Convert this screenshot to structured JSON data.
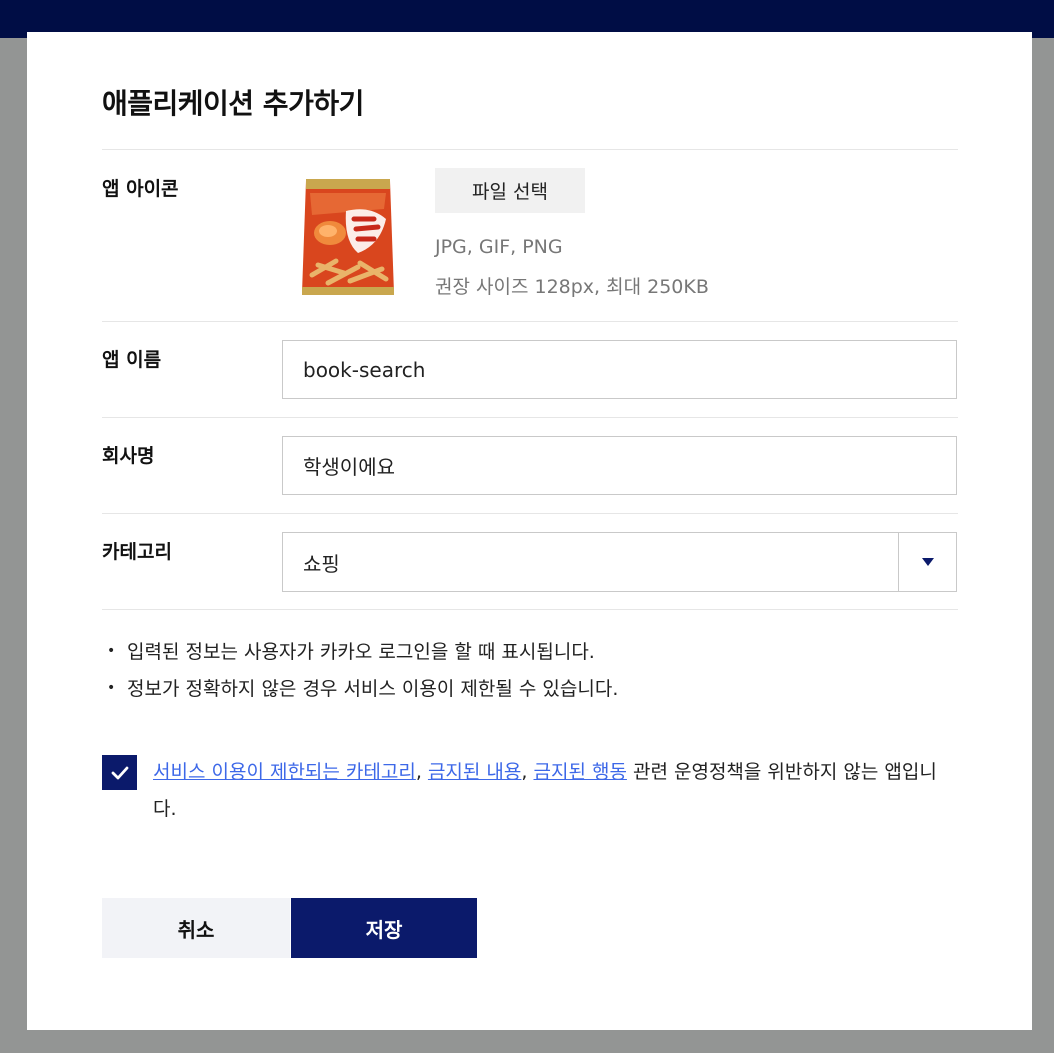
{
  "dialog": {
    "title": "애플리케이션 추가하기"
  },
  "icon_row": {
    "label": "앱 아이콘",
    "file_button": "파일 선택",
    "formats": "JPG, GIF, PNG",
    "size_hint": "권장 사이즈 128px, 최대 250KB"
  },
  "name_row": {
    "label": "앱 이름",
    "value": "book-search"
  },
  "company_row": {
    "label": "회사명",
    "value": "학생이에요"
  },
  "category_row": {
    "label": "카테고리",
    "value": "쇼핑"
  },
  "notes": [
    "입력된 정보는 사용자가 카카오 로그인을 할 때 표시됩니다.",
    "정보가 정확하지 않은 경우 서비스 이용이 제한될 수 있습니다."
  ],
  "agreement": {
    "checked": true,
    "link1": "서비스 이용이 제한되는 카테고리",
    "sep1": ",",
    "link2": "금지된 내용",
    "sep2": ",",
    "link3": "금지된 행동",
    "text_end": "관련 운영정책을 위반하지 않는 앱입니다."
  },
  "buttons": {
    "cancel": "취소",
    "save": "저장"
  },
  "colors": {
    "header": "#000d45",
    "overlay": "#939594",
    "primary": "#0b1a6b",
    "link": "#3d68e8"
  }
}
